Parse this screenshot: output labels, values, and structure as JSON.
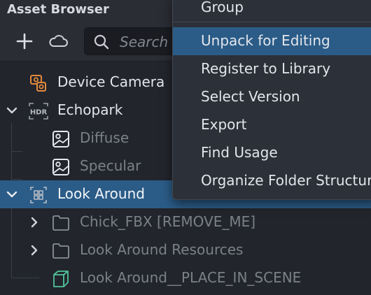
{
  "panel": {
    "title": "Asset Browser"
  },
  "toolbar": {
    "search_placeholder": "Search"
  },
  "tree": [
    {
      "label": "Device Camera",
      "dim": false
    },
    {
      "label": "Echopark",
      "dim": false
    },
    {
      "label": "Diffuse",
      "dim": true
    },
    {
      "label": "Specular",
      "dim": true
    },
    {
      "label": "Look Around",
      "dim": false,
      "selected": true
    },
    {
      "label": "Chick_FBX [REMOVE_ME]",
      "dim": true
    },
    {
      "label": "Look Around Resources",
      "dim": true
    },
    {
      "label": "Look Around__PLACE_IN_SCENE",
      "dim": true
    }
  ],
  "context_menu": {
    "items": [
      "Group",
      "Unpack for Editing",
      "Register to Library",
      "Select Version",
      "Export",
      "Find Usage",
      "Organize Folder Structure"
    ],
    "highlighted": "Unpack for Editing"
  },
  "icons": {
    "add": "plus-icon",
    "cloud": "cloud-icon",
    "search": "search-icon",
    "camera": "device-camera-icon",
    "hdr": "hdr-icon",
    "texture": "texture-icon",
    "group": "object-group-icon",
    "folder": "folder-icon",
    "prefab": "cube-icon",
    "expand": "chevron-down-icon",
    "collapse": "chevron-right-icon"
  },
  "colors": {
    "selection": "#2b5c88",
    "camera_icon": "#e38a3c",
    "prefab_icon": "#4fc39a"
  }
}
